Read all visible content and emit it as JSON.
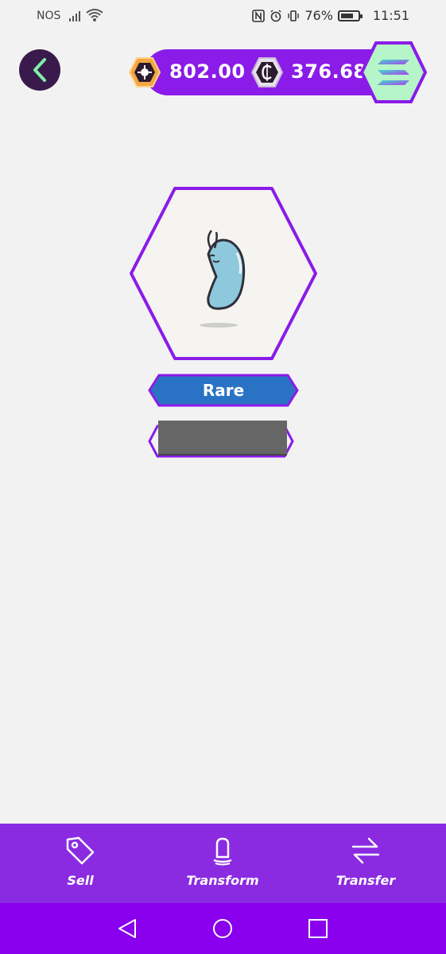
{
  "status_bar": {
    "carrier": "NOS",
    "battery_percent": "76%",
    "battery_level": 0.76,
    "time": "11:51",
    "icons": [
      "signal-icon",
      "wifi-icon",
      "nfc-icon",
      "alarm-icon",
      "vibrate-icon",
      "battery-icon"
    ]
  },
  "header": {
    "back_icon": "chevron-left-icon",
    "balances": [
      {
        "icon": "gem-coin-icon",
        "value": "802.00"
      },
      {
        "icon": "credit-coin-icon",
        "value": "376.68"
      }
    ],
    "network_icon": "solana-icon"
  },
  "nft": {
    "image": "blue-bean-creature",
    "rarity": "Rare",
    "name": ""
  },
  "actions": [
    {
      "label": "Sell",
      "icon": "tag-icon"
    },
    {
      "label": "Transform",
      "icon": "capsule-icon"
    },
    {
      "label": "Transfer",
      "icon": "transfer-arrows-icon"
    }
  ],
  "colors": {
    "accent": "#8a2be2",
    "nav": "#8a00ee",
    "rarity": "#2a73c4",
    "back_button": "#3a1a4d",
    "solana_badge": "#b5f5c8"
  }
}
